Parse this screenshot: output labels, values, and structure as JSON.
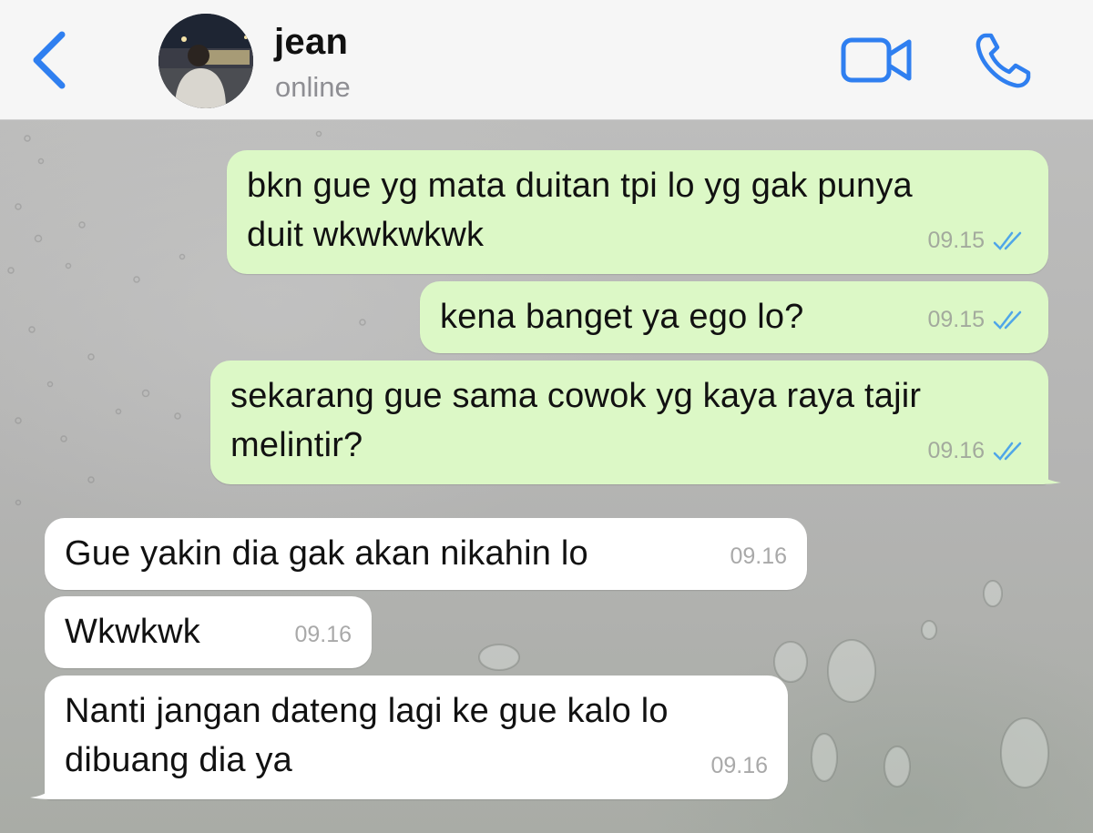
{
  "header": {
    "contact_name": "jean",
    "status": "online",
    "icons": {
      "back": "chevron-left-icon",
      "video": "video-camera-icon",
      "call": "phone-icon"
    },
    "accent_color": "#2f7ff0"
  },
  "messages": [
    {
      "direction": "outgoing",
      "text": "bkn gue yg mata duitan tpi lo yg gak punya\nduit wkwkwkwk",
      "time": "09.15",
      "read": true
    },
    {
      "direction": "outgoing",
      "text": "kena banget ya ego lo?",
      "time": "09.15",
      "read": true
    },
    {
      "direction": "outgoing",
      "text": "sekarang gue sama cowok yg kaya raya tajir\nmelintir?",
      "time": "09.16",
      "read": true
    },
    {
      "direction": "incoming",
      "text": "Gue yakin dia gak akan nikahin lo",
      "time": "09.16"
    },
    {
      "direction": "incoming",
      "text": "Wkwkwk",
      "time": "09.16"
    },
    {
      "direction": "incoming",
      "text": "Nanti jangan dateng lagi ke gue kalo lo\ndibuang dia ya",
      "time": "09.16"
    }
  ],
  "colors": {
    "outgoing_bubble": "#dcf8c6",
    "incoming_bubble": "#ffffff",
    "read_ticks": "#4fa6e8"
  }
}
